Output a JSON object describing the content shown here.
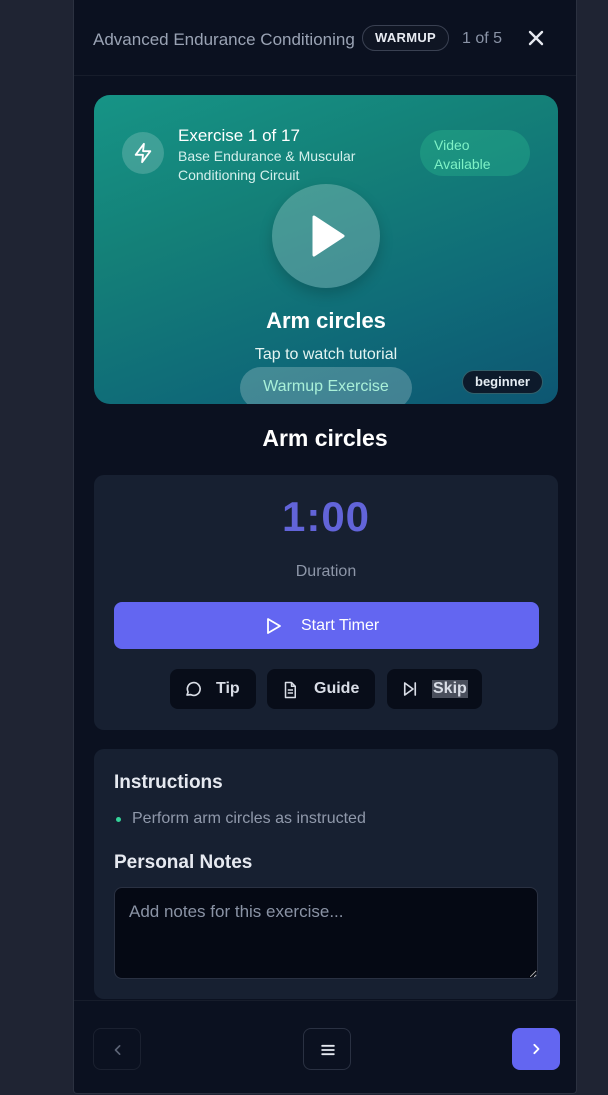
{
  "header": {
    "title": "Advanced Endurance Conditioning",
    "phase_badge": "WARMUP",
    "counter": "1 of 5"
  },
  "hero": {
    "exercise_number": "Exercise 1 of 17",
    "circuit": "Base Endurance & Muscular Conditioning Circuit",
    "video_badge": "Video Available",
    "name": "Arm circles",
    "tap_hint": "Tap to watch tutorial",
    "type_pill": "Warmup Exercise",
    "level": "beginner",
    "gradient_colors": [
      "#169486",
      "#0d5672"
    ]
  },
  "exercise": {
    "title": "Arm circles"
  },
  "timer": {
    "value": "1:00",
    "caption": "Duration",
    "start_label": "Start Timer",
    "tip_label": "Tip",
    "guide_label": "Guide",
    "skip_label": "Skip"
  },
  "details": {
    "instructions_heading": "Instructions",
    "instructions": [
      "Perform arm circles as instructed"
    ],
    "notes_heading": "Personal Notes",
    "notes_placeholder": "Add notes for this exercise...",
    "notes_value": ""
  },
  "footer": {
    "prev_icon": "chevron-left-icon",
    "menu_icon": "menu-icon",
    "next_icon": "chevron-right-icon"
  },
  "colors": {
    "accent": "#6366f1",
    "background": "#0b1120",
    "card": "#172031",
    "success": "#34d399"
  }
}
